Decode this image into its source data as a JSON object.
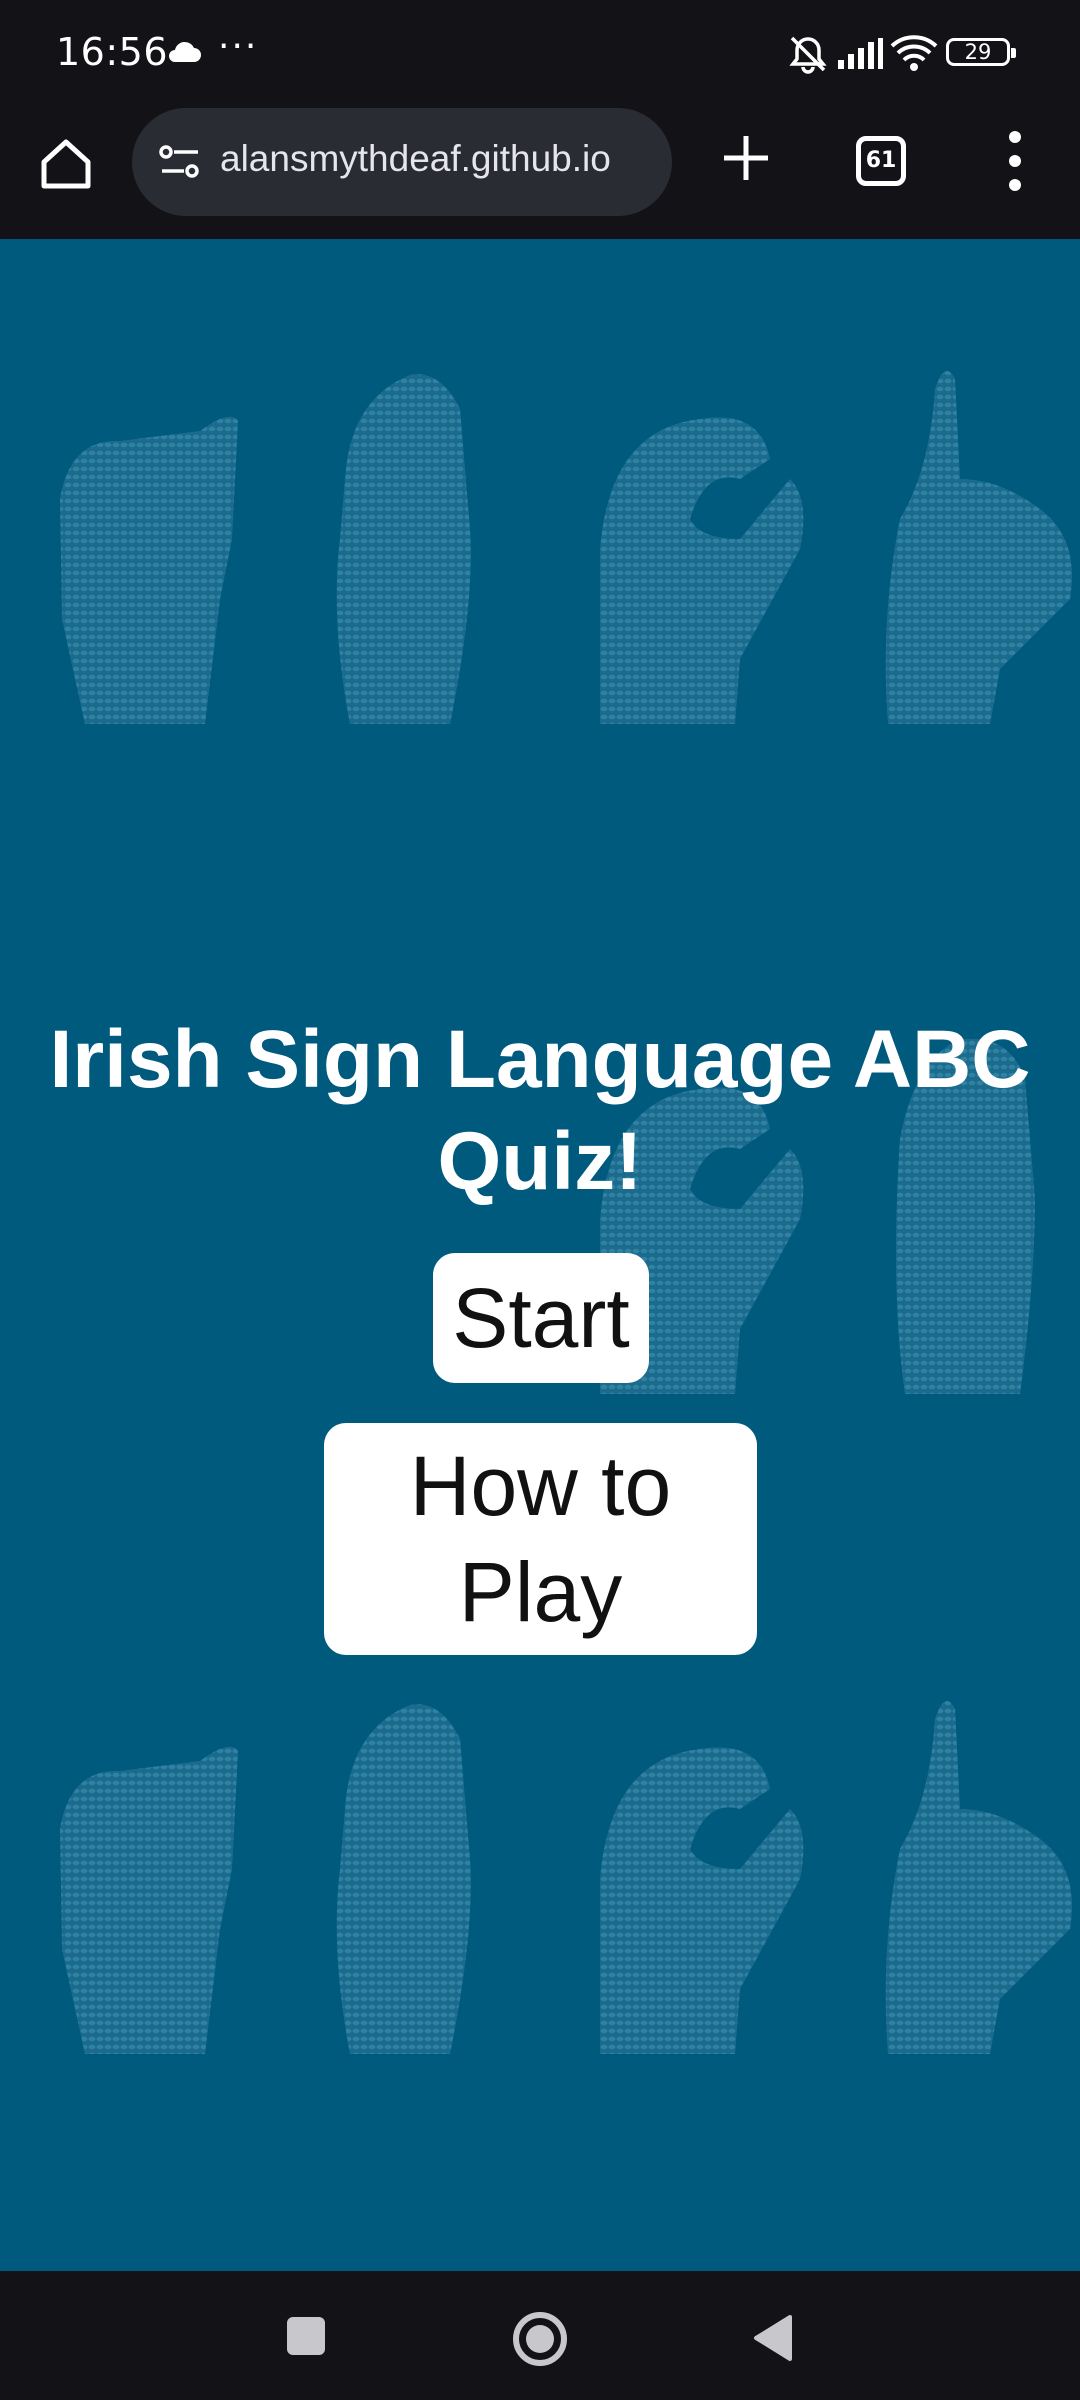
{
  "status_bar": {
    "time": "16:56",
    "overflow": "···",
    "battery": "29",
    "icons": [
      "cloud-icon",
      "mute-icon",
      "signal-icon",
      "wifi-icon",
      "battery-icon"
    ]
  },
  "browser": {
    "url": "alansmythdeaf.github.io",
    "tab_count": "61",
    "icons": [
      "home-icon",
      "site-settings-icon",
      "new-tab-icon",
      "tabs-icon",
      "menu-icon"
    ]
  },
  "page": {
    "background_color": "#005a7e",
    "title": "Irish Sign Language ABC Quiz!",
    "start_label": "Start",
    "howto_label": "How to Play"
  },
  "nav": {
    "icons": [
      "recents-icon",
      "home-icon",
      "back-icon"
    ]
  }
}
